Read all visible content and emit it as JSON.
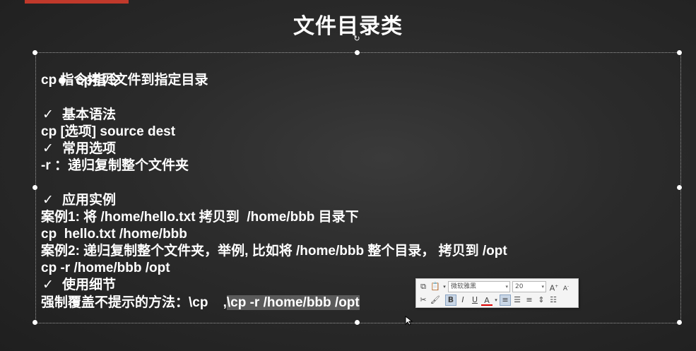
{
  "slide": {
    "title": "文件目录类",
    "heading": "cp指令",
    "lines": [
      {
        "kind": "text",
        "text": "cp 指令拷贝文件到指定目录"
      },
      {
        "kind": "blank",
        "text": ""
      },
      {
        "kind": "check",
        "text": "基本语法"
      },
      {
        "kind": "text",
        "text": "cp [选项] source dest"
      },
      {
        "kind": "check",
        "text": "常用选项"
      },
      {
        "kind": "text",
        "text": "-r ：递归复制整个文件夹"
      },
      {
        "kind": "blank",
        "text": ""
      },
      {
        "kind": "check",
        "text": "应用实例"
      },
      {
        "kind": "text",
        "text": "案例1: 将 /home/hello.txt 拷贝到  /home/bbb 目录下"
      },
      {
        "kind": "text",
        "text": "cp  hello.txt /home/bbb"
      },
      {
        "kind": "text",
        "text": "案例2: 递归复制整个文件夹，举例, 比如将 /home/bbb 整个目录， 拷贝到 /opt"
      },
      {
        "kind": "text",
        "text": "cp -r /home/bbb /opt"
      },
      {
        "kind": "check",
        "text": "使用细节"
      }
    ],
    "last_line": {
      "prefix": "强制覆盖不提示的方法：\\cp    ,",
      "highlighted": "\\cp -r /home/bbb /opt"
    }
  },
  "mini_toolbar": {
    "font_name": "微软雅黑",
    "font_size": "20",
    "grow_font": "A",
    "shrink_font": "A",
    "bold": "B",
    "italic": "I",
    "underline": "U",
    "font_color": "A"
  },
  "colors": {
    "chalkboard": "#2b2b2b",
    "text": "#ffffff",
    "accent_tab": "#c0392b",
    "highlight": "#5a5a5a"
  }
}
